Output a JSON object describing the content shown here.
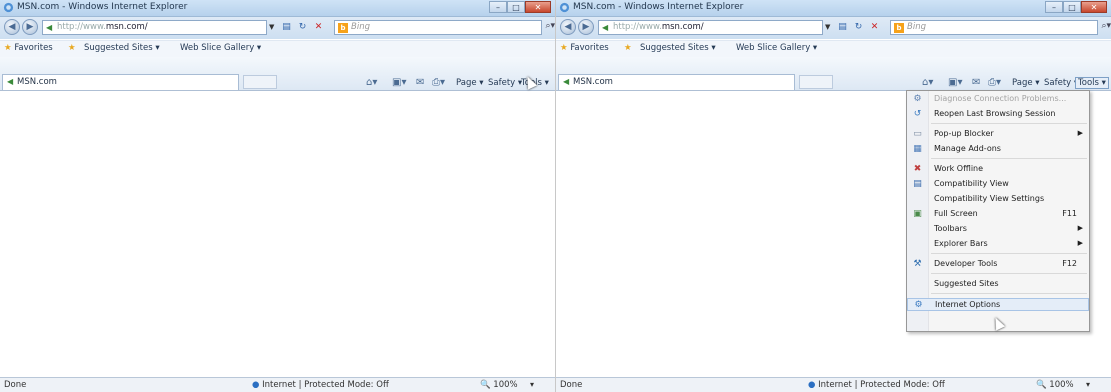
{
  "window": {
    "title": "MSN.com - Windows Internet Explorer",
    "minimize": "–",
    "maximize": "□",
    "close": "✕"
  },
  "nav": {
    "back": "◀",
    "forward": "▶",
    "address_prefix": "http://www.",
    "address_domain": "msn.com/",
    "search_placeholder": "Bing"
  },
  "favorites_bar": {
    "favorites": "Favorites",
    "suggested_sites": "Suggested Sites ▾",
    "web_slice_gallery": "Web Slice Gallery ▾"
  },
  "tab": {
    "label": "MSN.com"
  },
  "command_bar": {
    "page": "Page ▾",
    "safety": "Safety ▾",
    "tools": "Tools ▾",
    "help": "?▾"
  },
  "status_bar": {
    "status": "Done",
    "zone": "Internet | Protected Mode: Off",
    "zoom": "100%"
  },
  "tools_menu": {
    "items": [
      {
        "label": "Diagnose Connection Problems...",
        "shortcut": "",
        "submenu": false,
        "disabled": true,
        "icon": "diagnose-icon"
      },
      {
        "label": "Reopen Last Browsing Session",
        "shortcut": "",
        "submenu": false,
        "disabled": false,
        "icon": "reopen-icon"
      },
      {
        "label": "Pop-up Blocker",
        "shortcut": "",
        "submenu": true,
        "disabled": false,
        "icon": "popup-icon"
      },
      {
        "label": "Manage Add-ons",
        "shortcut": "",
        "submenu": false,
        "disabled": false,
        "icon": "addons-icon"
      },
      {
        "label": "Work Offline",
        "shortcut": "",
        "submenu": false,
        "disabled": false,
        "icon": "offline-icon"
      },
      {
        "label": "Compatibility View",
        "shortcut": "",
        "submenu": false,
        "disabled": false,
        "icon": "compat-icon"
      },
      {
        "label": "Compatibility View Settings",
        "shortcut": "",
        "submenu": false,
        "disabled": false,
        "icon": ""
      },
      {
        "label": "Full Screen",
        "shortcut": "F11",
        "submenu": false,
        "disabled": false,
        "icon": "fullscreen-icon"
      },
      {
        "label": "Toolbars",
        "shortcut": "",
        "submenu": true,
        "disabled": false,
        "icon": ""
      },
      {
        "label": "Explorer Bars",
        "shortcut": "",
        "submenu": true,
        "disabled": false,
        "icon": ""
      },
      {
        "label": "Developer Tools",
        "shortcut": "F12",
        "submenu": false,
        "disabled": false,
        "icon": "devtools-icon"
      },
      {
        "label": "Suggested Sites",
        "shortcut": "",
        "submenu": false,
        "disabled": false,
        "icon": ""
      },
      {
        "label": "Internet Options",
        "shortcut": "",
        "submenu": false,
        "disabled": false,
        "icon": "options-icon",
        "hover": true
      }
    ]
  }
}
